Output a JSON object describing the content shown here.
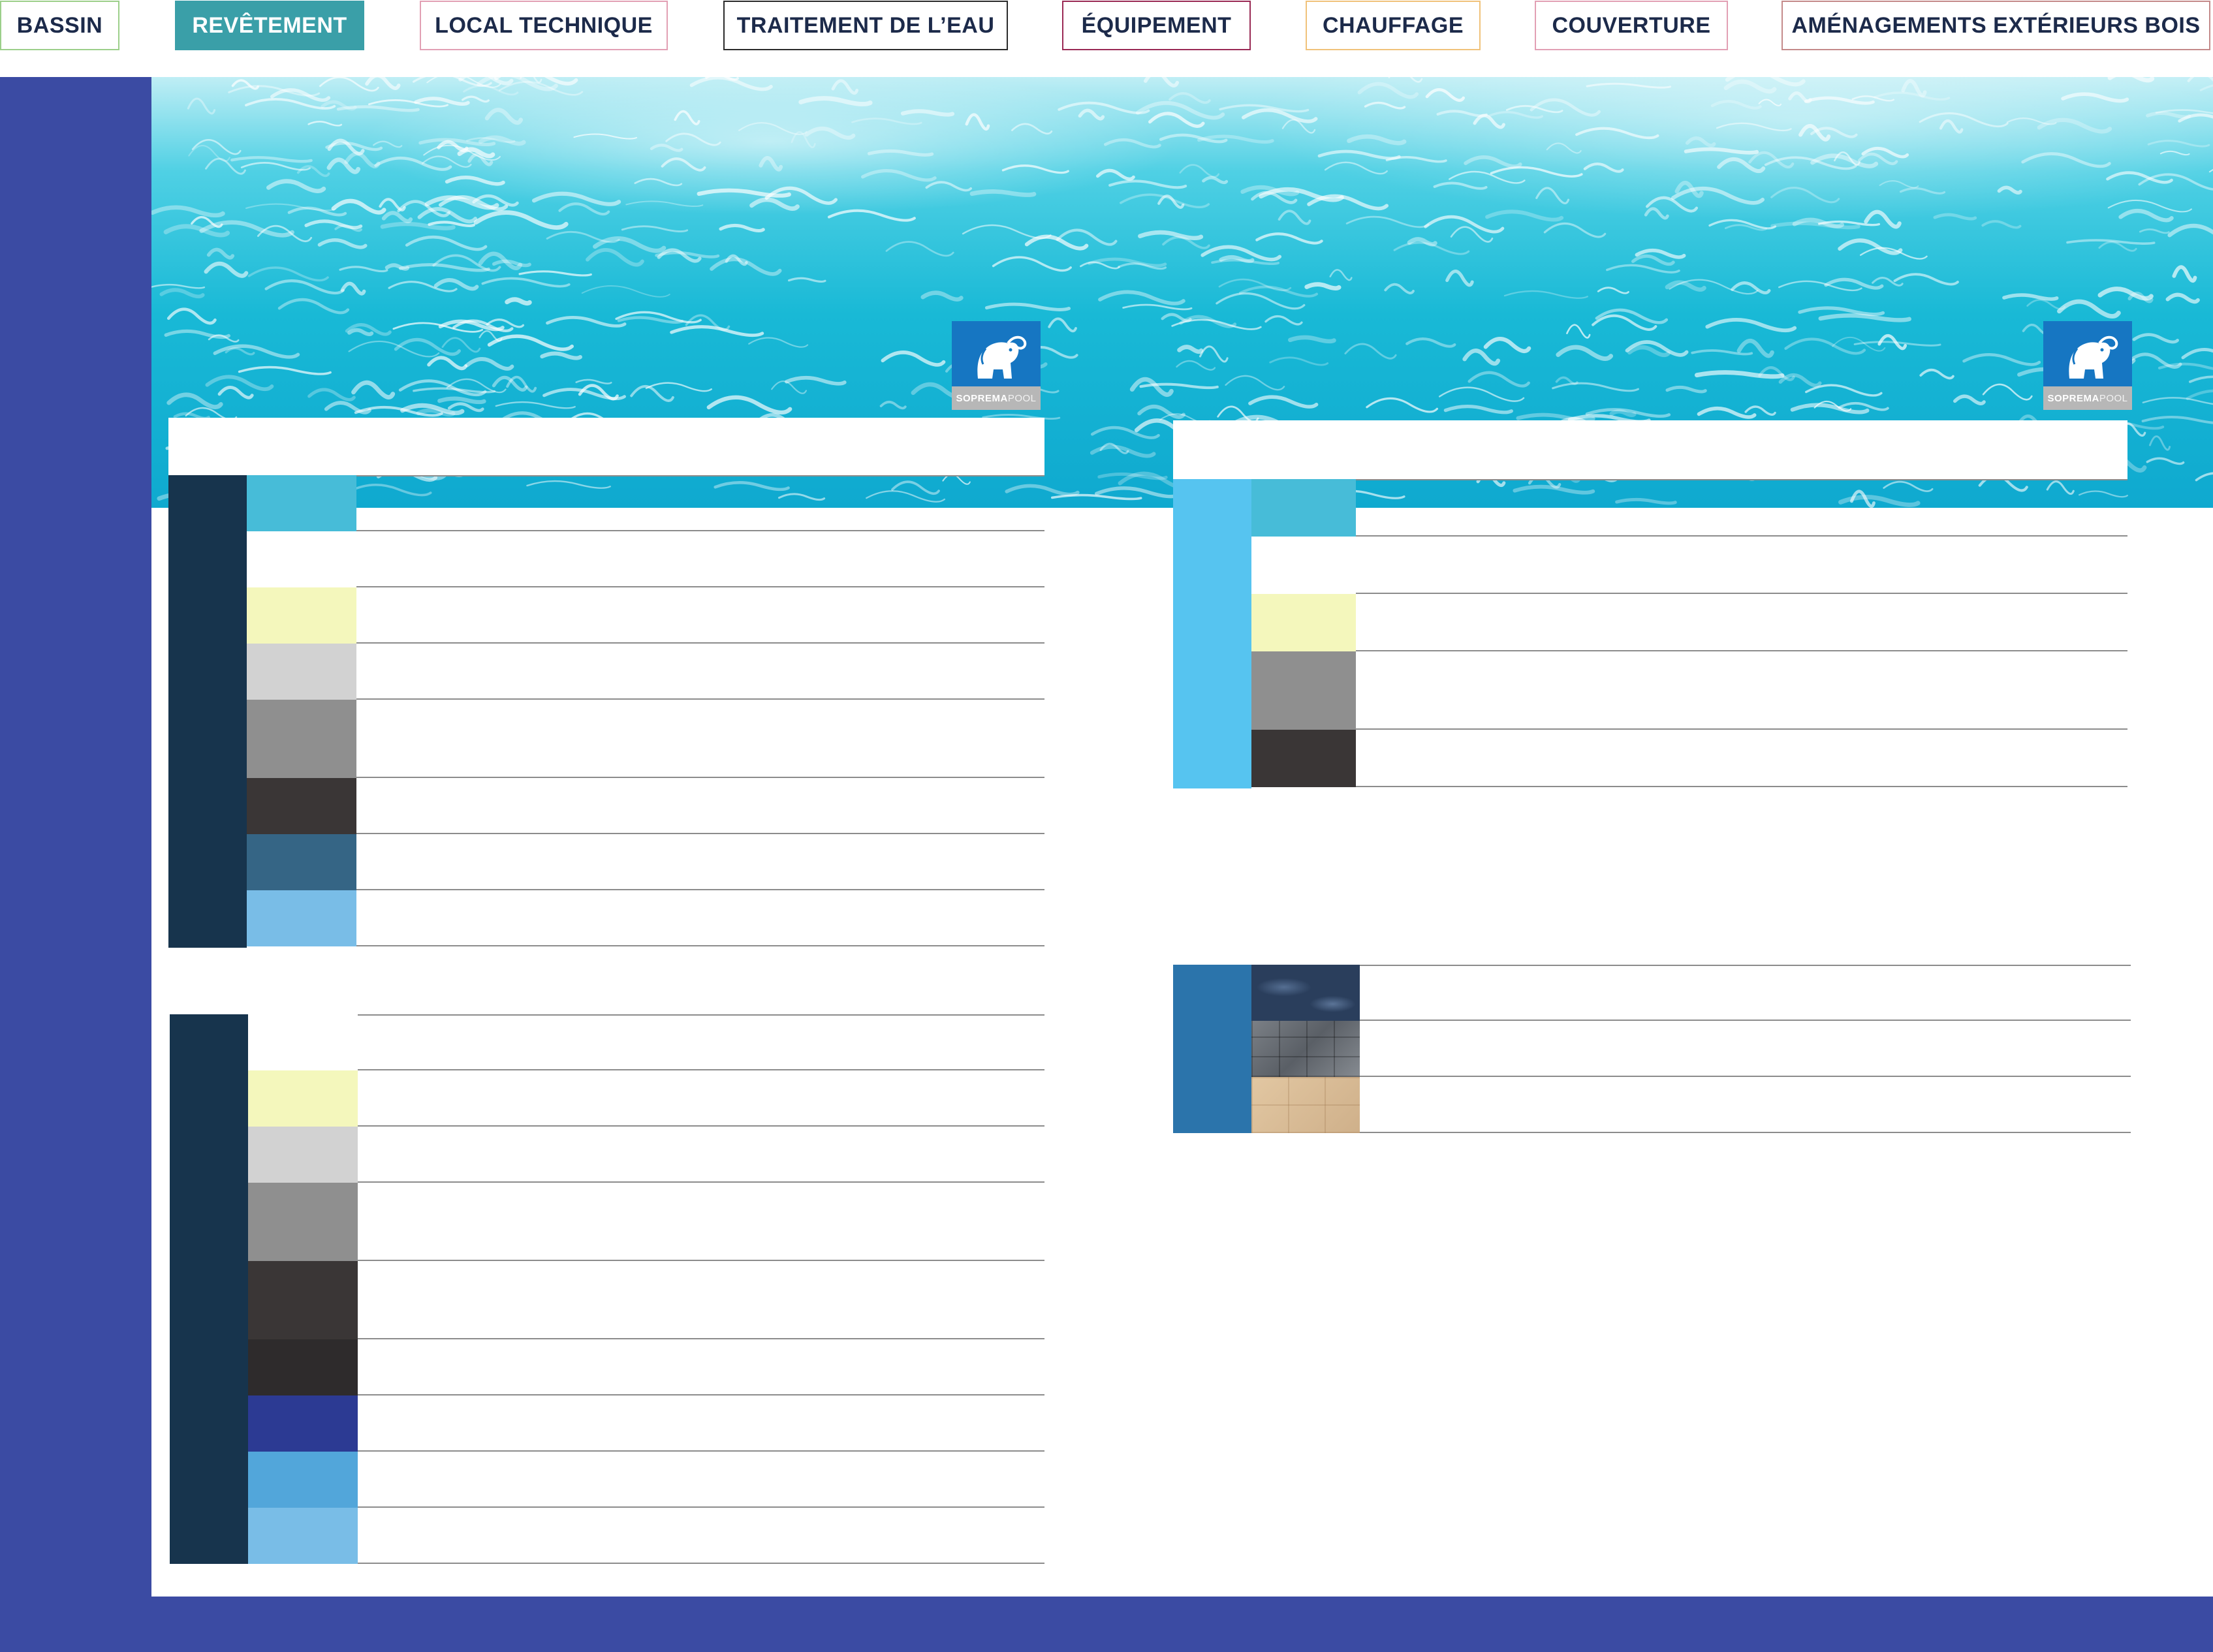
{
  "nav": {
    "tabs": [
      {
        "label": "BASSIN",
        "border": "#9ccf8a",
        "active": false
      },
      {
        "label": "REVÊTEMENT",
        "border": "#3a9fa8",
        "active": true,
        "fill": "#3a9fa8"
      },
      {
        "label": "LOCAL TECHNIQUE",
        "border": "#e2a0b4",
        "active": false
      },
      {
        "label": "TRAITEMENT DE L’EAU",
        "border": "#2b2b2b",
        "active": false
      },
      {
        "label": "ÉQUIPEMENT",
        "border": "#9a2a55",
        "active": false
      },
      {
        "label": "CHAUFFAGE",
        "border": "#f0c27a",
        "active": false
      },
      {
        "label": "COUVERTURE",
        "border": "#e2a0b4",
        "active": false
      },
      {
        "label": "AMÉNAGEMENTS EXTÉRIEURS BOIS",
        "border": "#c48a8a",
        "active": false
      }
    ]
  },
  "frame": {
    "band_color": "#3b4ba3",
    "dark_panel_color": "#17344d"
  },
  "logos": [
    {
      "brand": "SOPREMA",
      "suffix": "POOL",
      "icon": "elephant-icon"
    },
    {
      "brand": "SOPREMA",
      "suffix": "POOL",
      "icon": "elephant-icon"
    }
  ],
  "panels": [
    {
      "id": "panel-top-left",
      "bar_color": "#17344d",
      "swatches": [
        {
          "color": "#47bcd8",
          "label": ""
        },
        {
          "color": "#ffffff",
          "label": ""
        },
        {
          "color": "#f4f7bc",
          "label": ""
        },
        {
          "color": "#d2d2d2",
          "label": ""
        },
        {
          "color": "#8f8f8f",
          "label": ""
        },
        {
          "color": "#3a3636",
          "label": ""
        },
        {
          "color": "#356585",
          "label": ""
        },
        {
          "color": "#79bde7",
          "label": ""
        }
      ]
    },
    {
      "id": "panel-bottom-left",
      "bar_color": "#17344d",
      "swatches": [
        {
          "color": "#ffffff",
          "label": ""
        },
        {
          "color": "#f4f7bc",
          "label": ""
        },
        {
          "color": "#d2d2d2",
          "label": ""
        },
        {
          "color": "#8f8f8f",
          "label": ""
        },
        {
          "color": "#3a3636",
          "label": ""
        },
        {
          "color": "#2e2b2c",
          "label": ""
        },
        {
          "color": "#2c3a93",
          "label": ""
        },
        {
          "color": "#52a6da",
          "label": ""
        },
        {
          "color": "#79bde7",
          "label": ""
        }
      ]
    },
    {
      "id": "panel-top-right",
      "bar_color": "#56c4f0",
      "swatches": [
        {
          "color": "#47bcd8",
          "label": ""
        },
        {
          "color": "#ffffff",
          "label": ""
        },
        {
          "color": "#f4f7bc",
          "label": ""
        },
        {
          "color": "#8f8f8f",
          "label": ""
        },
        {
          "color": "#3a3636",
          "label": ""
        }
      ]
    },
    {
      "id": "panel-textures",
      "bar_color": "#2b74ab",
      "swatches": [
        {
          "color": "#2a3e5c",
          "texture": "marble",
          "label": ""
        },
        {
          "color": "#6d7277",
          "texture": "stone-tiles",
          "label": ""
        },
        {
          "color": "#d7bb95",
          "texture": "sand-tiles",
          "label": ""
        }
      ]
    }
  ]
}
